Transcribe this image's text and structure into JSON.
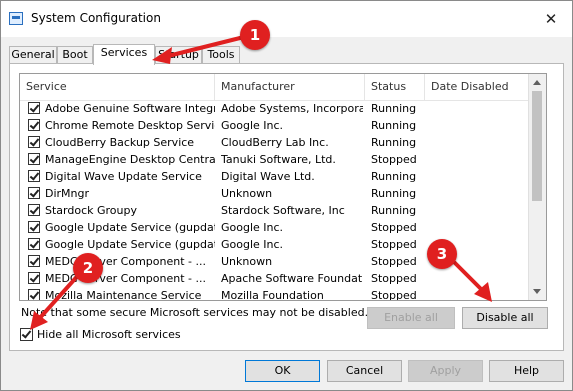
{
  "window": {
    "title": "System Configuration",
    "close_glyph": "✕"
  },
  "tabs": [
    {
      "label": "General"
    },
    {
      "label": "Boot"
    },
    {
      "label": "Services"
    },
    {
      "label": "Startup"
    },
    {
      "label": "Tools"
    }
  ],
  "table": {
    "headers": [
      "Service",
      "Manufacturer",
      "Status",
      "Date Disabled"
    ],
    "rows": [
      {
        "service": "Adobe Genuine Software Integri...",
        "manufacturer": "Adobe Systems, Incorpora...",
        "status": "Running",
        "checked": true
      },
      {
        "service": "Chrome Remote Desktop Service",
        "manufacturer": "Google Inc.",
        "status": "Running",
        "checked": true
      },
      {
        "service": "CloudBerry Backup Service",
        "manufacturer": "CloudBerry Lab Inc.",
        "status": "Running",
        "checked": true
      },
      {
        "service": "ManageEngine Desktop Central ...",
        "manufacturer": "Tanuki Software, Ltd.",
        "status": "Stopped",
        "checked": true
      },
      {
        "service": "Digital Wave Update Service",
        "manufacturer": "Digital Wave Ltd.",
        "status": "Running",
        "checked": true
      },
      {
        "service": "DirMngr",
        "manufacturer": "Unknown",
        "status": "Running",
        "checked": true
      },
      {
        "service": "Stardock Groupy",
        "manufacturer": "Stardock Software, Inc",
        "status": "Running",
        "checked": true
      },
      {
        "service": "Google Update Service (gupdate)",
        "manufacturer": "Google Inc.",
        "status": "Stopped",
        "checked": true
      },
      {
        "service": "Google Update Service (gupdatem)",
        "manufacturer": "Google Inc.",
        "status": "Stopped",
        "checked": true
      },
      {
        "service": "MEDC Server Component - ...",
        "manufacturer": "Unknown",
        "status": "Stopped",
        "checked": true
      },
      {
        "service": "MEDC Server Component - ...",
        "manufacturer": "Apache Software Foundation",
        "status": "Stopped",
        "checked": true
      },
      {
        "service": "Mozilla Maintenance Service",
        "manufacturer": "Mozilla Foundation",
        "status": "Stopped",
        "checked": true
      }
    ]
  },
  "note": "Note that some secure Microsoft services may not be disabled.",
  "buttons": {
    "enable_all": "Enable all",
    "disable_all": "Disable all",
    "ok": "OK",
    "cancel": "Cancel",
    "apply": "Apply",
    "help": "Help"
  },
  "hide_ms": {
    "label": "Hide all Microsoft services",
    "checked": true
  },
  "annotations": [
    "1",
    "2",
    "3"
  ],
  "colors": {
    "annotation": "#e02020",
    "focus_border": "#0078d7"
  }
}
